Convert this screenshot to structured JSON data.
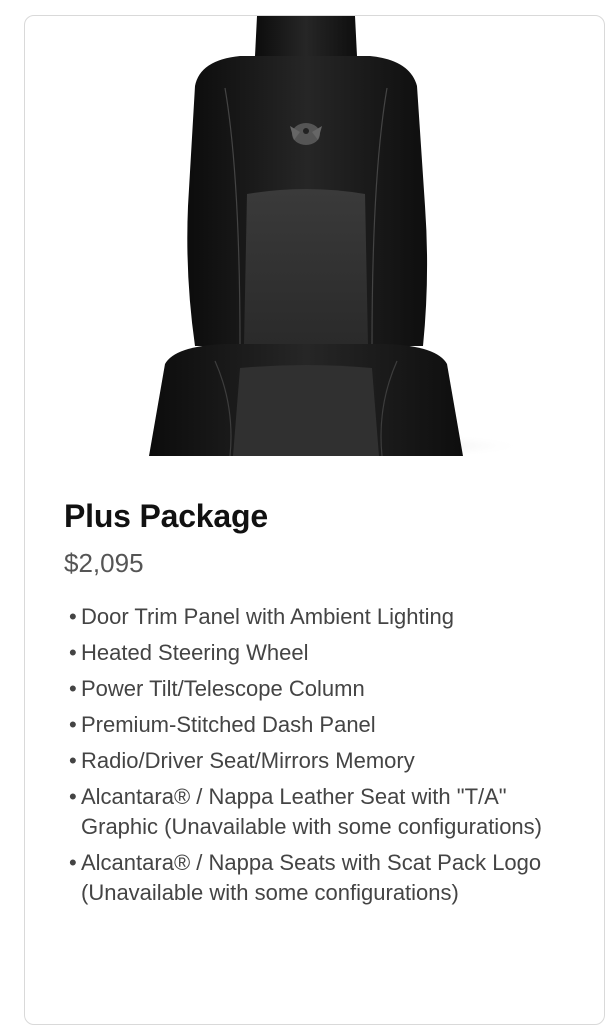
{
  "package": {
    "image_alt": "Alcantara / Nappa leather seat with Scat Pack logo",
    "title": "Plus Package",
    "price": "$2,095",
    "features": [
      "Door Trim Panel with Ambient Lighting",
      "Heated Steering Wheel",
      "Power Tilt/Telescope Column",
      "Premium-Stitched Dash Panel",
      "Radio/Driver Seat/Mirrors Memory",
      "Alcantara® / Nappa Leather Seat with \"T/A\" Graphic (Unavailable with some configurations)",
      "Alcantara® / Nappa Seats with Scat Pack Logo (Unavailable with some configurations)"
    ],
    "bullet": "•"
  }
}
